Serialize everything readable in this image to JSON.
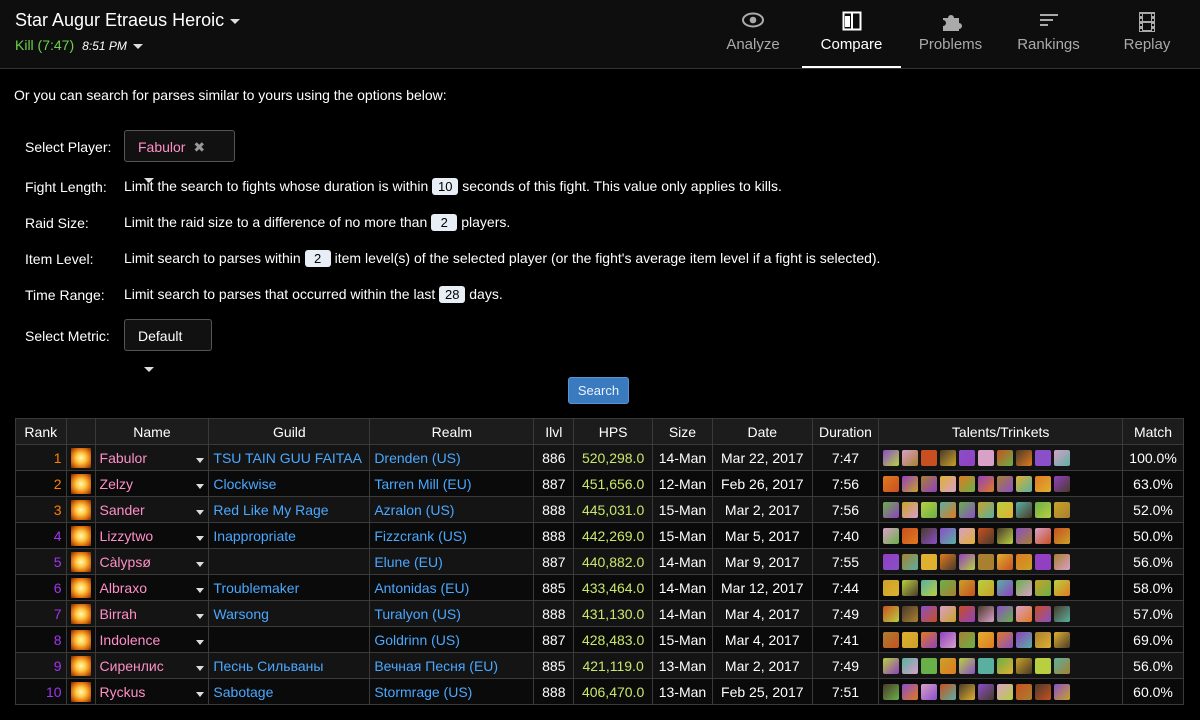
{
  "header": {
    "fight_title": "Star Augur Etraeus Heroic",
    "kill_label": "Kill (7:47)",
    "time": "8:51 PM"
  },
  "nav": [
    {
      "label": "Analyze",
      "icon": "eye-icon"
    },
    {
      "label": "Compare",
      "icon": "compare-icon",
      "active": true
    },
    {
      "label": "Problems",
      "icon": "puzzle-icon"
    },
    {
      "label": "Rankings",
      "icon": "bars-icon"
    },
    {
      "label": "Replay",
      "icon": "film-icon"
    }
  ],
  "intro": "Or you can search for parses similar to yours using the options below:",
  "options": {
    "player": {
      "label": "Select Player:",
      "value": "Fabulor"
    },
    "fight_length": {
      "label": "Fight Length:",
      "pre": "Limit the search to fights whose duration is within",
      "value": "10",
      "post": "seconds of this fight. This value only applies to kills."
    },
    "raid_size": {
      "label": "Raid Size:",
      "pre": "Limit the raid size to a difference of no more than",
      "value": "2",
      "post": "players."
    },
    "item_level": {
      "label": "Item Level:",
      "pre": "Limit search to parses within",
      "value": "2",
      "post": "item level(s) of the selected player (or the fight's average item level if a fight is selected)."
    },
    "time_range": {
      "label": "Time Range:",
      "pre": "Limit search to parses that occurred within the last",
      "value": "28",
      "post": "days."
    },
    "metric": {
      "label": "Select Metric:",
      "value": "Default"
    }
  },
  "search_label": "Search",
  "table": {
    "headers": [
      "Rank",
      "Name",
      "Guild",
      "Realm",
      "Ilvl",
      "HPS",
      "Size",
      "Date",
      "Duration",
      "Talents/Trinkets",
      "Match"
    ],
    "rows": [
      {
        "rank": "1",
        "name": "Fabulor",
        "guild": "TSU TAIN GUU FAITAA",
        "realm": "Drenden (US)",
        "ilvl": "886",
        "hps": "520,298.0",
        "size": "14-Man",
        "date": "Mar 22, 2017",
        "duration": "7:47",
        "match": "100.0%",
        "rank_color": "#ff8000"
      },
      {
        "rank": "2",
        "name": "Zelzy",
        "guild": "Clockwise",
        "realm": "Tarren Mill (EU)",
        "ilvl": "887",
        "hps": "451,656.0",
        "size": "12-Man",
        "date": "Feb 26, 2017",
        "duration": "7:56",
        "match": "63.0%",
        "rank_color": "#ff8000"
      },
      {
        "rank": "3",
        "name": "Sander",
        "guild": "Red Like My Rage",
        "realm": "Azralon (US)",
        "ilvl": "888",
        "hps": "445,031.0",
        "size": "15-Man",
        "date": "Mar 2, 2017",
        "duration": "7:56",
        "match": "52.0%",
        "rank_color": "#ff8000"
      },
      {
        "rank": "4",
        "name": "Lizzytwo",
        "guild": "Inappropriate",
        "realm": "Fizzcrank (US)",
        "ilvl": "888",
        "hps": "442,269.0",
        "size": "15-Man",
        "date": "Mar 5, 2017",
        "duration": "7:40",
        "match": "50.0%",
        "rank_color": "#a335ee"
      },
      {
        "rank": "5",
        "name": "Càlypsø",
        "guild": "",
        "realm": "Elune (EU)",
        "ilvl": "887",
        "hps": "440,882.0",
        "size": "14-Man",
        "date": "Mar 9, 2017",
        "duration": "7:55",
        "match": "56.0%",
        "rank_color": "#a335ee"
      },
      {
        "rank": "6",
        "name": "Albraxo",
        "guild": "Troublemaker",
        "realm": "Antonidas (EU)",
        "ilvl": "885",
        "hps": "433,464.0",
        "size": "14-Man",
        "date": "Mar 12, 2017",
        "duration": "7:44",
        "match": "58.0%",
        "rank_color": "#a335ee"
      },
      {
        "rank": "7",
        "name": "Birrah",
        "guild": "Warsong",
        "realm": "Turalyon (US)",
        "ilvl": "888",
        "hps": "431,130.0",
        "size": "14-Man",
        "date": "Mar 4, 2017",
        "duration": "7:49",
        "match": "57.0%",
        "rank_color": "#a335ee"
      },
      {
        "rank": "8",
        "name": "Indolence",
        "guild": "",
        "realm": "Goldrinn (US)",
        "ilvl": "887",
        "hps": "428,483.0",
        "size": "15-Man",
        "date": "Mar 4, 2017",
        "duration": "7:41",
        "match": "69.0%",
        "rank_color": "#a335ee"
      },
      {
        "rank": "9",
        "name": "Сиренлис",
        "guild": "Песнь Сильваны",
        "realm": "Вечная Песня (EU)",
        "ilvl": "885",
        "hps": "421,119.0",
        "size": "13-Man",
        "date": "Mar 2, 2017",
        "duration": "7:49",
        "match": "56.0%",
        "rank_color": "#a335ee"
      },
      {
        "rank": "10",
        "name": "Ryckus",
        "guild": "Sabotage",
        "realm": "Stormrage (US)",
        "ilvl": "888",
        "hps": "406,470.0",
        "size": "13-Man",
        "date": "Feb 25, 2017",
        "duration": "7:51",
        "match": "60.0%",
        "rank_color": "#a335ee"
      }
    ]
  },
  "colors": {
    "kill": "#6dd34a",
    "link": "#4aa8ff",
    "name": "#ff8fc8",
    "hps": "#c9e86b",
    "legendary": "#ff8000",
    "epic": "#a335ee",
    "search_button": "#3a7abf"
  }
}
